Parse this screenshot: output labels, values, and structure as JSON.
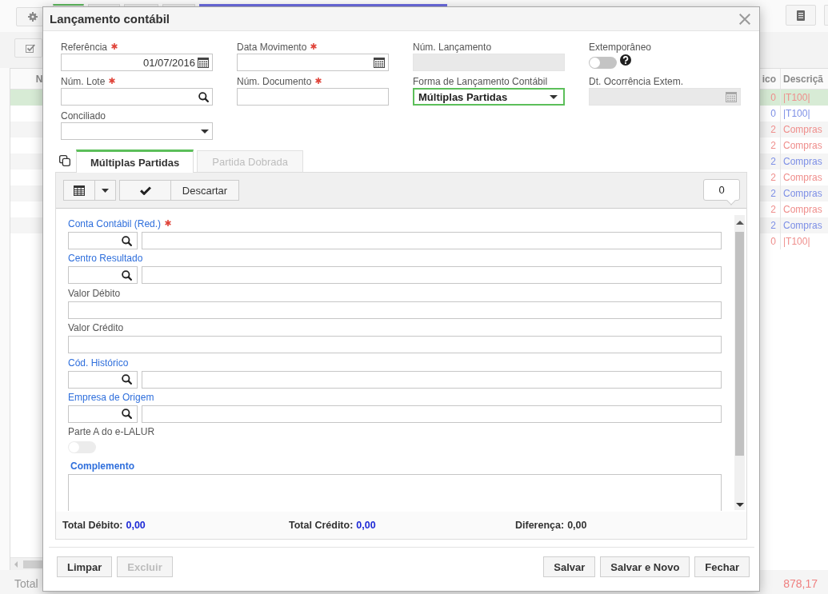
{
  "app": {
    "table": {
      "columns": [
        {
          "label": "N"
        },
        {
          "label": "ico"
        },
        {
          "label": "Descriçã"
        }
      ],
      "rows": [
        {
          "selected": true,
          "color": "#ef8e8c",
          "column_2": "0",
          "column_3": "|T100|"
        },
        {
          "selected": false,
          "color": "#7d8fe6",
          "column_2": "0",
          "column_3": "|T100|"
        },
        {
          "selected": false,
          "color": "#ef8e8c",
          "column_2": "2",
          "column_3": "Compras"
        },
        {
          "selected": false,
          "color": "#ef8e8c",
          "column_2": "2",
          "column_3": "Compras"
        },
        {
          "selected": false,
          "color": "#7d8fe6",
          "column_2": "2",
          "column_3": "Compras"
        },
        {
          "selected": false,
          "color": "#ef8e8c",
          "column_2": "2",
          "column_3": "Compras"
        },
        {
          "selected": false,
          "color": "#7d8fe6",
          "column_2": "2",
          "column_3": "Compras"
        },
        {
          "selected": false,
          "color": "#ef8e8c",
          "column_2": "2",
          "column_3": "Compras"
        },
        {
          "selected": false,
          "color": "#7d8fe6",
          "column_2": "2",
          "column_3": "Compras"
        },
        {
          "selected": false,
          "color": "#ef8e8c",
          "column_2": "0",
          "column_3": "|T100|"
        }
      ]
    },
    "footer": {
      "label": "Total",
      "value": "878,17"
    }
  },
  "dialog": {
    "title": "Lançamento contábil",
    "header_fields": [
      {
        "kind": "date",
        "label": "Referência",
        "required": true,
        "value": "01/07/2016",
        "disabled": false,
        "focused": false,
        "help": false
      },
      {
        "kind": "date",
        "label": "Data Movimento",
        "required": true,
        "disabled": false,
        "focused": false,
        "help": false
      },
      {
        "kind": "text",
        "label": "Núm. Lançamento",
        "required": false,
        "disabled": true,
        "focused": false,
        "help": false
      },
      {
        "kind": "toggle",
        "label": "Extemporâneo",
        "required": false,
        "on": false,
        "disabled": false,
        "focused": false,
        "help": true
      },
      {
        "kind": "lookup",
        "label": "Núm. Lote",
        "required": true,
        "disabled": false,
        "focused": false,
        "help": false
      },
      {
        "kind": "text",
        "label": "Núm. Documento",
        "required": true,
        "disabled": false,
        "focused": false,
        "help": false
      },
      {
        "kind": "select",
        "label": "Forma de Lançamento Contábil",
        "required": false,
        "value": "Múltiplas Partidas",
        "disabled": false,
        "focused": true,
        "help": false
      },
      {
        "kind": "date",
        "label": "Dt. Ocorrência Extem.",
        "required": false,
        "disabled": true,
        "focused": false,
        "help": false
      },
      {
        "kind": "select",
        "label": "Conciliado",
        "required": false,
        "disabled": false,
        "focused": false,
        "help": false
      }
    ],
    "tabs": [
      {
        "label": "Múltiplas Partidas",
        "selected": true,
        "disabled": false
      },
      {
        "label": "Partida Dobrada",
        "selected": false,
        "disabled": true
      }
    ],
    "entry_toolbar": {
      "discard_label": "Descartar",
      "count": "0"
    },
    "entry_fields": [
      {
        "kind": "lookup_pair",
        "label": "Conta Contábil (Red.)",
        "link": true,
        "required": true,
        "disabled": false
      },
      {
        "kind": "lookup_pair",
        "label": "Centro Resultado",
        "link": true,
        "required": false,
        "disabled": false
      },
      {
        "kind": "text",
        "label": "Valor Débito",
        "link": false,
        "required": false,
        "disabled": false
      },
      {
        "kind": "text",
        "label": "Valor Crédito",
        "link": false,
        "required": false,
        "disabled": false
      },
      {
        "kind": "lookup_pair",
        "label": "Cód. Histórico",
        "link": true,
        "required": false,
        "disabled": false
      },
      {
        "kind": "lookup_pair",
        "label": "Empresa de Origem",
        "link": true,
        "required": false,
        "disabled": false
      },
      {
        "kind": "toggle",
        "label": "Parte A do e-LALUR",
        "link": false,
        "required": false,
        "disabled": true,
        "on": false
      },
      {
        "kind": "textarea",
        "label": "Complemento",
        "link": true,
        "required": false,
        "disabled": false
      }
    ],
    "totals": [
      {
        "label": "Total Débito:",
        "value": "0,00",
        "color": "#1f2bd6"
      },
      {
        "label": "Total Crédito:",
        "value": "0,00",
        "color": "#1f2bd6"
      },
      {
        "label": "Diferença:",
        "value": "0,00",
        "color": "#333333"
      }
    ],
    "left_buttons": [
      {
        "label": "Limpar",
        "disabled": false
      },
      {
        "label": "Excluir",
        "disabled": true
      }
    ],
    "right_buttons": [
      {
        "label": "Salvar",
        "disabled": false
      },
      {
        "label": "Salvar e Novo",
        "disabled": false
      },
      {
        "label": "Fechar",
        "disabled": false
      }
    ]
  }
}
